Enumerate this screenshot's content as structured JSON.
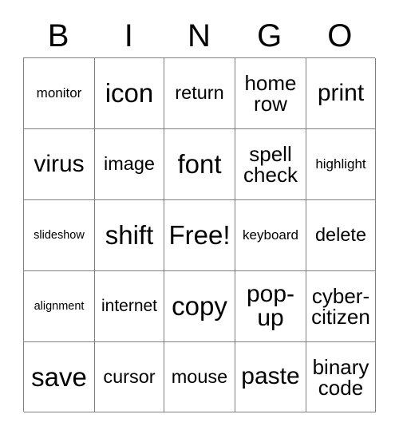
{
  "card": {
    "title": "BINGO",
    "headers": [
      "B",
      "I",
      "N",
      "G",
      "O"
    ],
    "border_color": "#808080",
    "text_color": "#000000",
    "background_color": "#ffffff",
    "rows": 5,
    "columns": 5,
    "free_space": "Free!",
    "cells": [
      [
        {
          "text": "monitor",
          "size": "fs-s",
          "lines": 1
        },
        {
          "text": "icon",
          "size": "fs-xxl",
          "lines": 1
        },
        {
          "text": "return",
          "size": "fs-ml",
          "lines": 1
        },
        {
          "text": "home\nrow",
          "size": "fs-l",
          "lines": 2
        },
        {
          "text": "print",
          "size": "fs-xl",
          "lines": 1
        }
      ],
      [
        {
          "text": "virus",
          "size": "fs-xl",
          "lines": 1
        },
        {
          "text": "image",
          "size": "fs-ml",
          "lines": 1
        },
        {
          "text": "font",
          "size": "fs-xxl",
          "lines": 1
        },
        {
          "text": "spell\ncheck",
          "size": "fs-l",
          "lines": 2
        },
        {
          "text": "highlight",
          "size": "fs-s",
          "lines": 1
        }
      ],
      [
        {
          "text": "slideshow",
          "size": "fs-xs",
          "lines": 1
        },
        {
          "text": "shift",
          "size": "fs-xxl",
          "lines": 1
        },
        {
          "text": "Free!",
          "size": "fs-xxl",
          "lines": 1
        },
        {
          "text": "keyboard",
          "size": "fs-s",
          "lines": 1
        },
        {
          "text": "delete",
          "size": "fs-ml",
          "lines": 1
        }
      ],
      [
        {
          "text": "alignment",
          "size": "fs-xs",
          "lines": 1
        },
        {
          "text": "internet",
          "size": "fs-m",
          "lines": 1
        },
        {
          "text": "copy",
          "size": "fs-xxl",
          "lines": 1
        },
        {
          "text": "pop-\nup",
          "size": "fs-xl",
          "lines": 2
        },
        {
          "text": "cyber-\ncitizen",
          "size": "fs-l",
          "lines": 2
        }
      ],
      [
        {
          "text": "save",
          "size": "fs-xxl",
          "lines": 1
        },
        {
          "text": "cursor",
          "size": "fs-ml",
          "lines": 1
        },
        {
          "text": "mouse",
          "size": "fs-ml",
          "lines": 1
        },
        {
          "text": "paste",
          "size": "fs-xl",
          "lines": 1
        },
        {
          "text": "binary\ncode",
          "size": "fs-l",
          "lines": 2
        }
      ]
    ]
  }
}
